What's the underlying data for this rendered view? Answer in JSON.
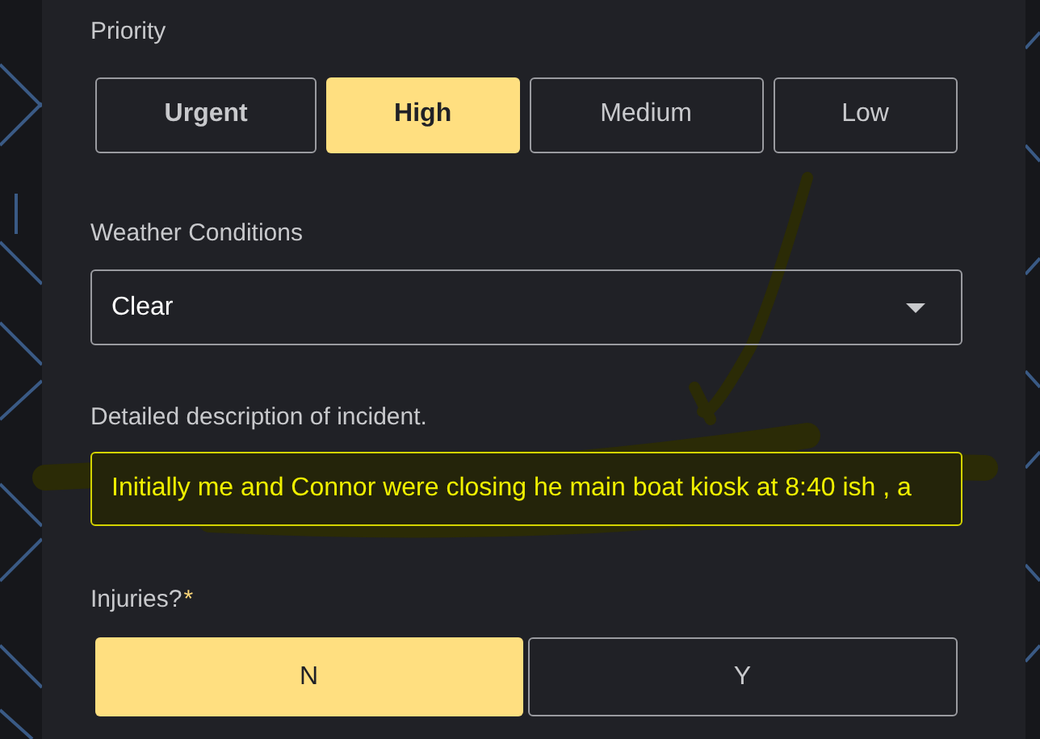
{
  "priority": {
    "label": "Priority",
    "options": [
      {
        "label": "Urgent",
        "selected": false,
        "bold": true
      },
      {
        "label": "High",
        "selected": true,
        "bold": true
      },
      {
        "label": "Medium",
        "selected": false,
        "bold": false
      },
      {
        "label": "Low",
        "selected": false,
        "bold": false
      }
    ]
  },
  "weather": {
    "label": "Weather Conditions",
    "value": "Clear"
  },
  "description": {
    "label": "Detailed description of incident.",
    "value": "Initially me and Connor were closing he main boat kiosk at 8:40 ish , a",
    "focused": true
  },
  "injuries": {
    "label": "Injuries?",
    "required_mark": "*",
    "options": [
      {
        "label": "N",
        "selected": true
      },
      {
        "label": "Y",
        "selected": false
      }
    ]
  }
}
